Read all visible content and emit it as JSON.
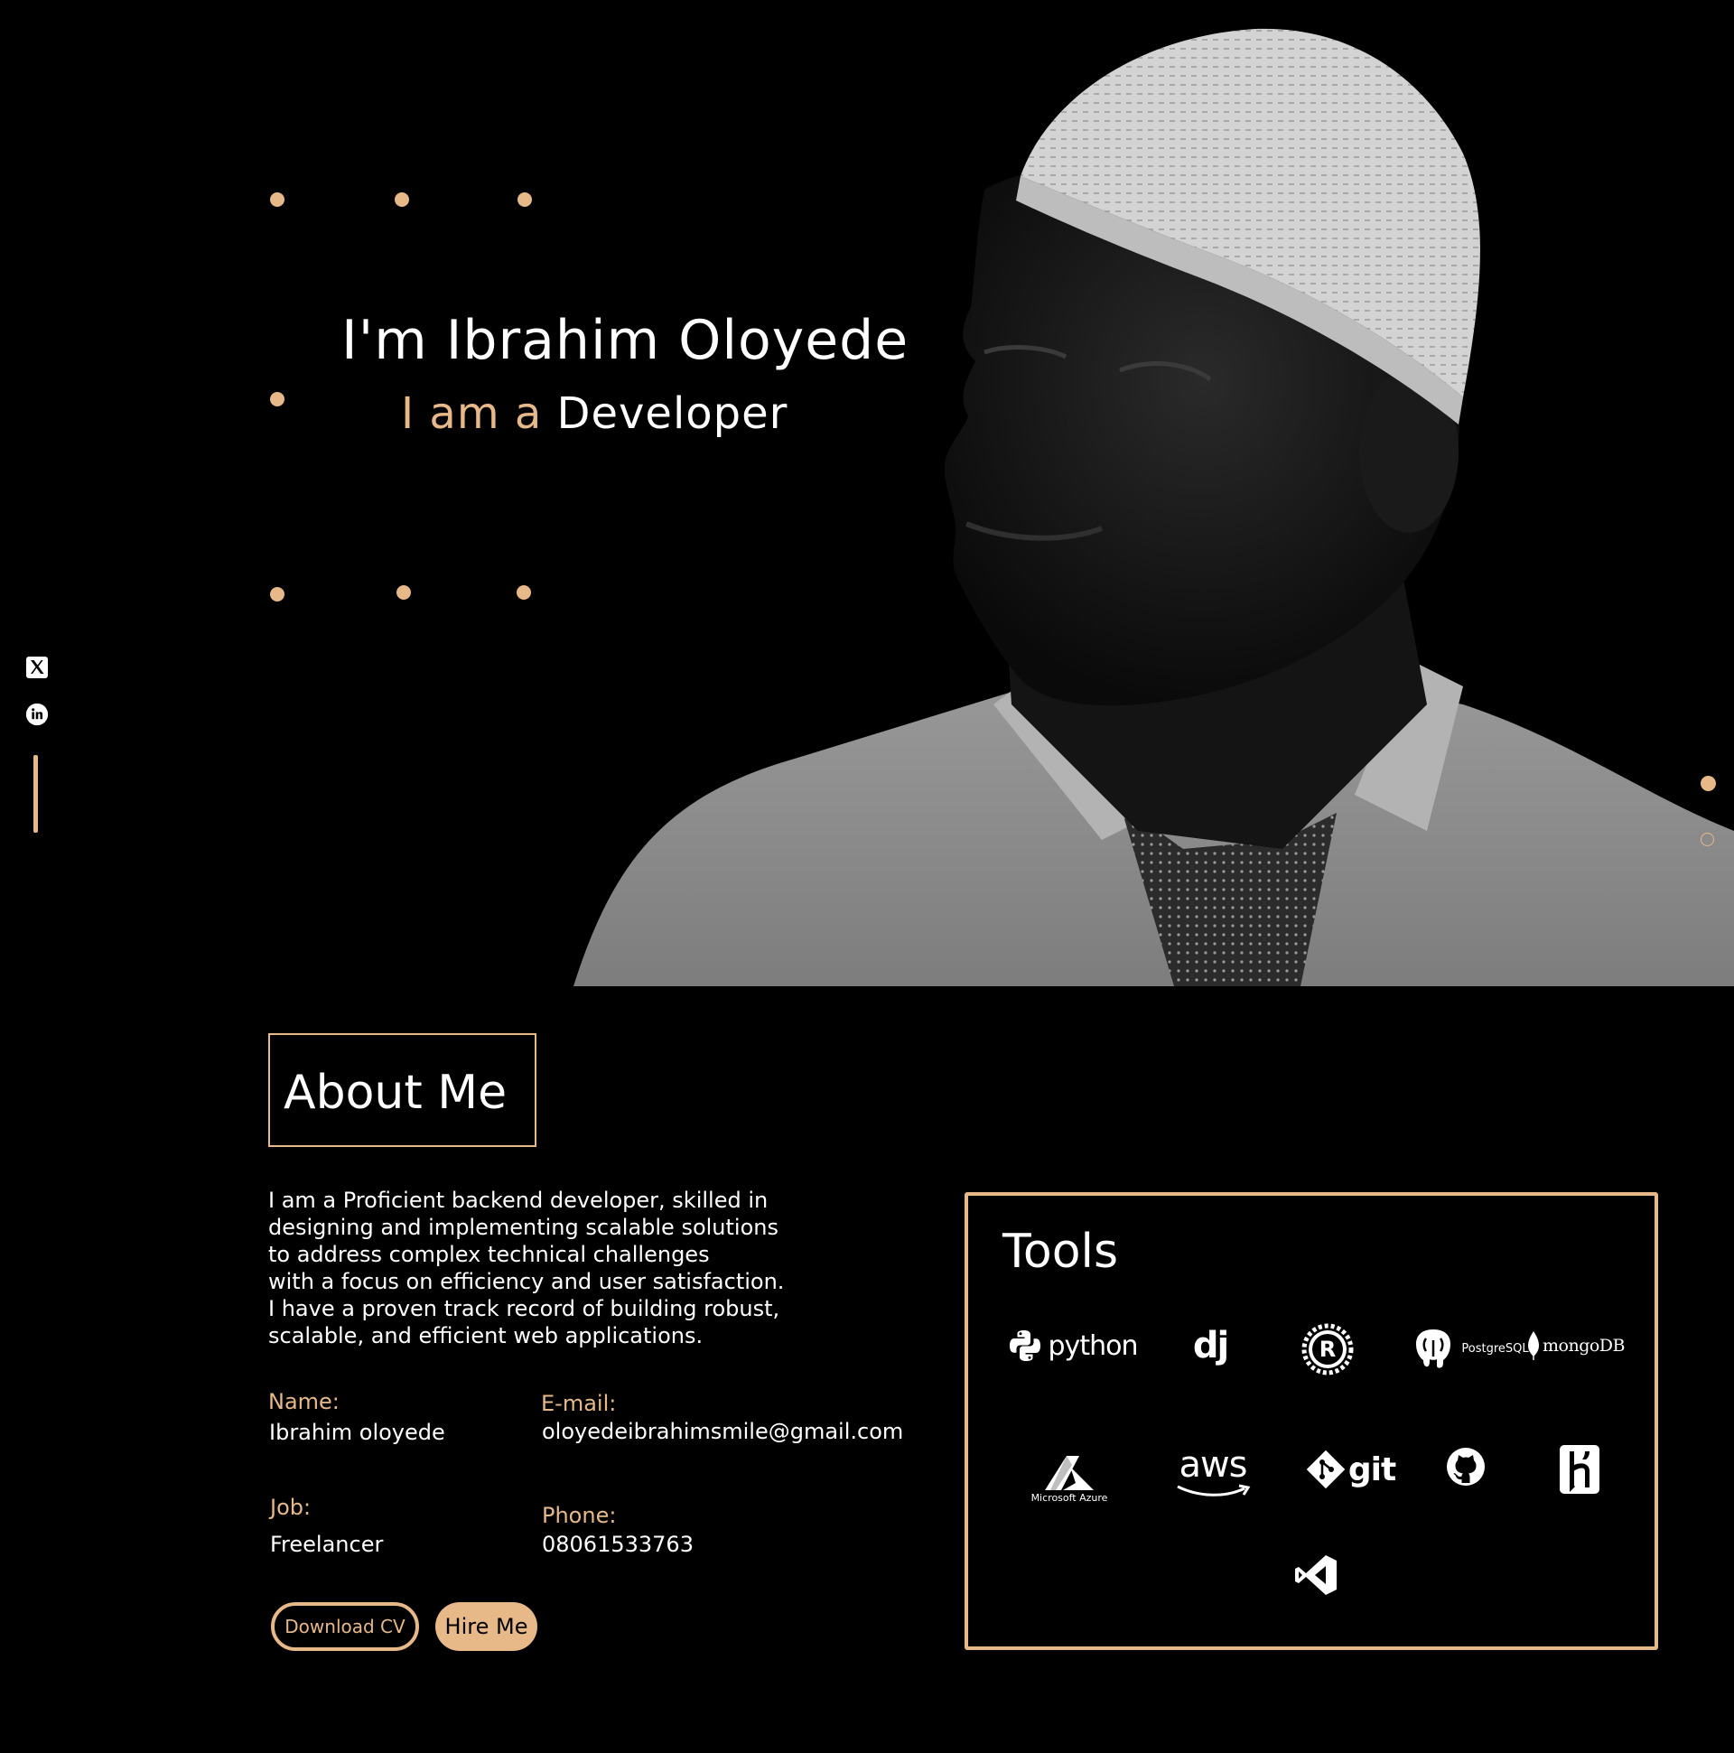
{
  "colors": {
    "accent": "#e7b888",
    "background": "#000000",
    "text": "#ffffff"
  },
  "hero": {
    "title": "I'm Ibrahim Oloyede",
    "subtitle_prefix": "I am a",
    "role": "Developer",
    "photo_alt": "Portrait of Ibrahim Oloyede wearing a white cap, shirt and tie"
  },
  "social": {
    "icons": [
      "x-icon",
      "linkedin-icon"
    ]
  },
  "slider": {
    "active_index": 0,
    "count": 2
  },
  "about": {
    "title": "About Me",
    "description": "I am a Proficient backend developer, skilled in\ndesigning and implementing scalable solutions\nto address complex technical challenges\nwith a focus on efficiency and user satisfaction.\nI have a proven track record of building robust,\nscalable, and efficient web applications.",
    "name_label": "Name:",
    "name_value": "Ibrahim oloyede",
    "email_label": "E-mail:",
    "email_value": "oloyedeibrahimsmile@gmail.com",
    "job_label": "Job:",
    "job_value": "Freelancer",
    "phone_label": "Phone:",
    "phone_value": "08061533763",
    "download_label": "Download CV",
    "hire_label": "Hire Me"
  },
  "tools": {
    "title": "Tools",
    "items": {
      "python": "python",
      "django": "dj",
      "rust": "R",
      "postgresql": "PostgreSQL",
      "mongodb": "mongoDB",
      "azure": "Microsoft Azure",
      "aws": "aws",
      "git": "git",
      "github": "github-icon",
      "heroku": "heroku-icon",
      "vscode": "vscode-icon"
    }
  }
}
